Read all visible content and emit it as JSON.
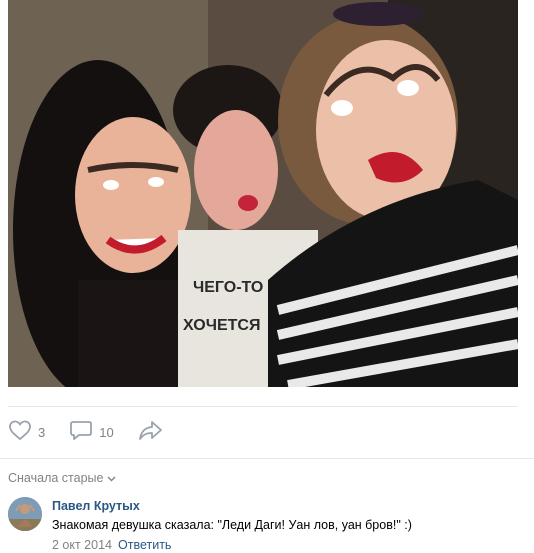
{
  "post": {
    "photo_icon": "selfie-photo"
  },
  "actions": {
    "like_count": "3",
    "comment_count": "10",
    "like_icon": "heart-icon",
    "comment_icon": "speech-bubble-icon",
    "share_icon": "share-arrow-icon"
  },
  "comments": {
    "sort_label": "Сначала старые",
    "items": [
      {
        "author": "Павел Крутых",
        "text": "Знакомая девушка сказала: \"Леди Даги! Уан лов, уан бров!\" :)",
        "date": "2 окт 2014",
        "reply_label": "Ответить"
      }
    ]
  },
  "colors": {
    "link": "#2a5885",
    "muted": "#828282",
    "divider": "#e7e8ec",
    "icon": "#99a2ad"
  }
}
